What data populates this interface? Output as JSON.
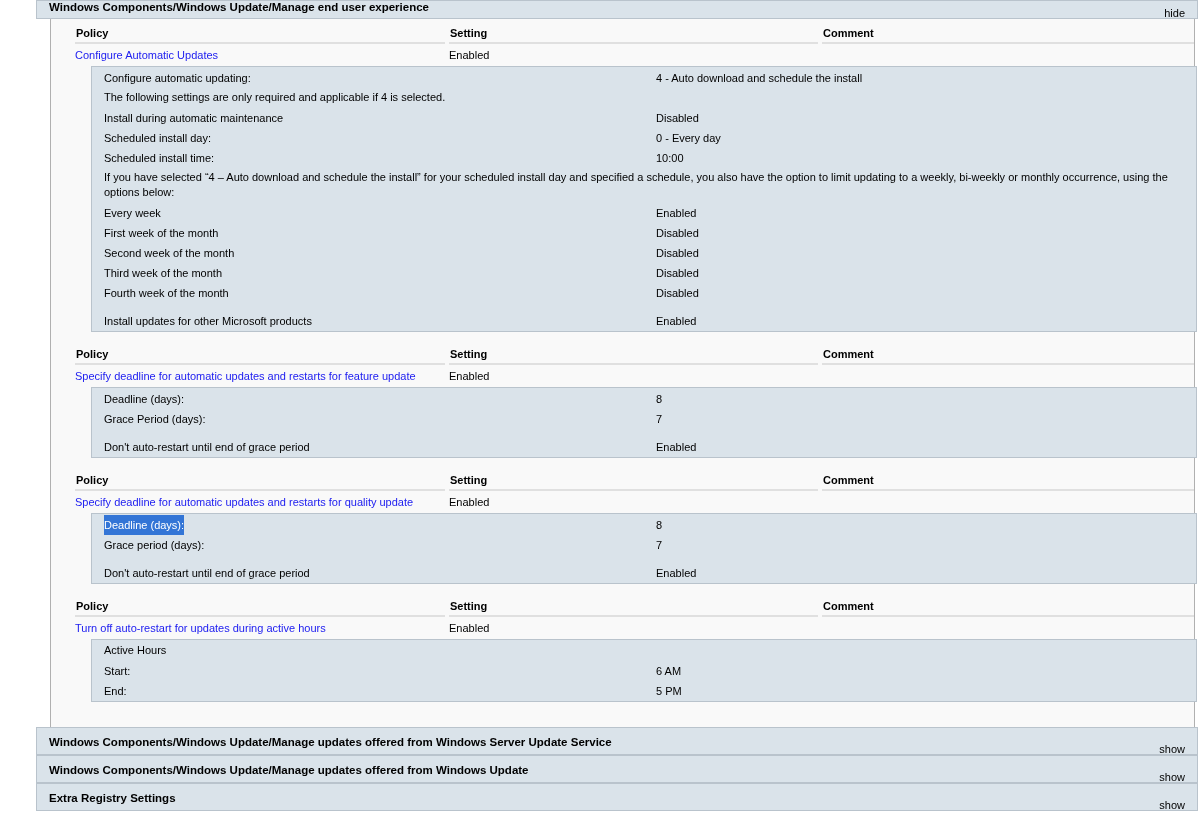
{
  "sections": [
    {
      "title": "Windows Components/Windows Update/Manage end user experience",
      "toggle": "hide",
      "expanded": true,
      "policies": [
        {
          "columns": [
            "Policy",
            "Setting",
            "Comment"
          ],
          "name": "Configure Automatic Updates",
          "setting": "Enabled",
          "details": [
            {
              "kind": "pair",
              "label": "Configure automatic updating:",
              "value": "4 - Auto download and schedule the install",
              "spaced": false,
              "highlighted": false
            },
            {
              "kind": "note",
              "label": "The following settings are only required and applicable if 4 is selected.",
              "spaced": false,
              "highlighted": false
            },
            {
              "kind": "pair",
              "label": "Install during automatic maintenance",
              "value": "Disabled",
              "spaced": false,
              "highlighted": false
            },
            {
              "kind": "pair",
              "label": "Scheduled install day:",
              "value": "0 - Every day",
              "spaced": false,
              "highlighted": false
            },
            {
              "kind": "pair",
              "label": "Scheduled install time:",
              "value": "10:00",
              "spaced": false,
              "highlighted": false
            },
            {
              "kind": "note",
              "label": "If you have selected “4 – Auto download and schedule the install” for your scheduled install day and specified a schedule, you also have the option to limit updating to a weekly, bi-weekly or monthly occurrence, using the options below:",
              "spaced": false,
              "highlighted": false
            },
            {
              "kind": "pair",
              "label": "Every week",
              "value": "Enabled",
              "spaced": false,
              "highlighted": false
            },
            {
              "kind": "pair",
              "label": "First week of the month",
              "value": "Disabled",
              "spaced": false,
              "highlighted": false
            },
            {
              "kind": "pair",
              "label": "Second week of the month",
              "value": "Disabled",
              "spaced": false,
              "highlighted": false
            },
            {
              "kind": "pair",
              "label": "Third week of the month",
              "value": "Disabled",
              "spaced": false,
              "highlighted": false
            },
            {
              "kind": "pair",
              "label": "Fourth week of the month",
              "value": "Disabled",
              "spaced": false,
              "highlighted": false
            },
            {
              "kind": "pair",
              "label": "Install updates for other Microsoft products",
              "value": "Enabled",
              "spaced": true,
              "highlighted": false
            }
          ]
        },
        {
          "columns": [
            "Policy",
            "Setting",
            "Comment"
          ],
          "name": "Specify deadline for automatic updates and restarts for feature update",
          "setting": "Enabled",
          "details": [
            {
              "kind": "pair",
              "label": "Deadline (days):",
              "value": "8",
              "spaced": false,
              "highlighted": false
            },
            {
              "kind": "pair",
              "label": "Grace Period (days):",
              "value": "7",
              "spaced": false,
              "highlighted": false
            },
            {
              "kind": "pair",
              "label": "Don't auto-restart until end of grace period",
              "value": "Enabled",
              "spaced": true,
              "highlighted": false
            }
          ]
        },
        {
          "columns": [
            "Policy",
            "Setting",
            "Comment"
          ],
          "name": "Specify deadline for automatic updates and restarts for quality update",
          "setting": "Enabled",
          "details": [
            {
              "kind": "pair",
              "label": "Deadline (days):",
              "value": "8",
              "spaced": false,
              "highlighted": true
            },
            {
              "kind": "pair",
              "label": "Grace period (days):",
              "value": "7",
              "spaced": false,
              "highlighted": false
            },
            {
              "kind": "pair",
              "label": "Don't auto-restart until end of grace period",
              "value": "Enabled",
              "spaced": true,
              "highlighted": false
            }
          ]
        },
        {
          "columns": [
            "Policy",
            "Setting",
            "Comment"
          ],
          "name": "Turn off auto-restart for updates during active hours",
          "setting": "Enabled",
          "details": [
            {
              "kind": "note",
              "label": "Active Hours",
              "spaced": false,
              "highlighted": false
            },
            {
              "kind": "pair",
              "label": "Start:",
              "value": "6 AM",
              "spaced": false,
              "highlighted": false
            },
            {
              "kind": "pair",
              "label": "End:",
              "value": "5 PM",
              "spaced": false,
              "highlighted": false
            }
          ]
        }
      ]
    },
    {
      "title": "Windows Components/Windows Update/Manage updates offered from Windows Server Update Service",
      "toggle": "show",
      "expanded": false
    },
    {
      "title": "Windows Components/Windows Update/Manage updates offered from Windows Update",
      "toggle": "show",
      "expanded": false
    },
    {
      "title": "Extra Registry Settings",
      "toggle": "show",
      "expanded": false
    }
  ]
}
